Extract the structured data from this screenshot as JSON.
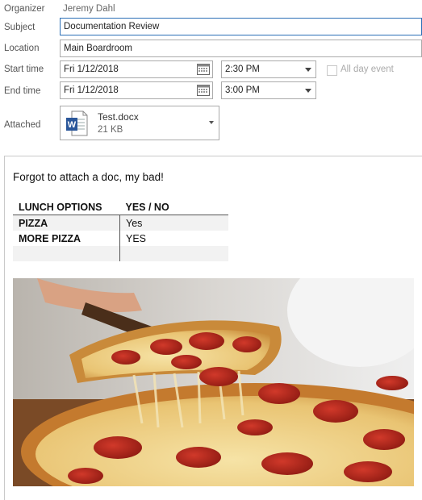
{
  "organizer": {
    "label": "Organizer",
    "value": "Jeremy Dahl"
  },
  "subject": {
    "label": "Subject",
    "value": "Documentation Review"
  },
  "location": {
    "label": "Location",
    "value": "Main Boardroom"
  },
  "start": {
    "label": "Start time",
    "date": "Fri 1/12/2018",
    "time": "2:30 PM"
  },
  "all_day": {
    "label": "All day event",
    "checked": false
  },
  "end": {
    "label": "End time",
    "date": "Fri 1/12/2018",
    "time": "3:00 PM"
  },
  "attachment": {
    "label": "Attached",
    "name": "Test.docx",
    "size": "21 KB",
    "icon": "word-doc-icon"
  },
  "body": {
    "message": "Forgot to attach a doc, my bad!",
    "table": {
      "headers": [
        "LUNCH OPTIONS",
        "YES / NO"
      ],
      "rows": [
        [
          "PIZZA",
          "Yes"
        ],
        [
          "MORE PIZZA",
          "YES"
        ],
        [
          "",
          ""
        ]
      ]
    }
  },
  "colors": {
    "focus_border": "#2b6fb6",
    "word_blue": "#2b579a"
  }
}
